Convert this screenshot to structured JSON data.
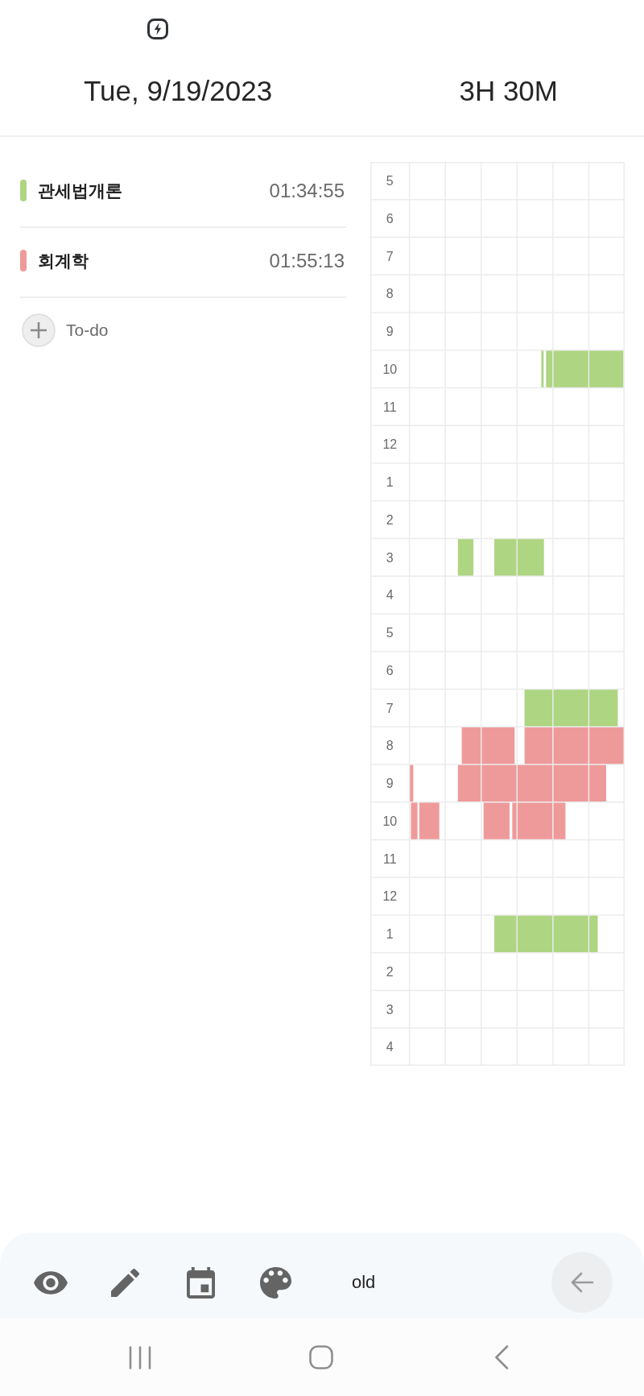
{
  "header": {
    "date": "Tue, 9/19/2023",
    "total": "3H 30M"
  },
  "subjects": [
    {
      "name": "관세법개론",
      "time": "01:34:55",
      "color": "#aed581"
    },
    {
      "name": "회계학",
      "time": "01:55:13",
      "color": "#ef9a9a"
    }
  ],
  "todo": {
    "label": "To-do"
  },
  "timetable": {
    "hours": [
      "5",
      "6",
      "7",
      "8",
      "9",
      "10",
      "11",
      "12",
      "1",
      "2",
      "3",
      "4",
      "5",
      "6",
      "7",
      "8",
      "9",
      "10",
      "11",
      "12",
      "1",
      "2",
      "3",
      "4"
    ]
  },
  "toolbar": {
    "mode_label": "old"
  }
}
